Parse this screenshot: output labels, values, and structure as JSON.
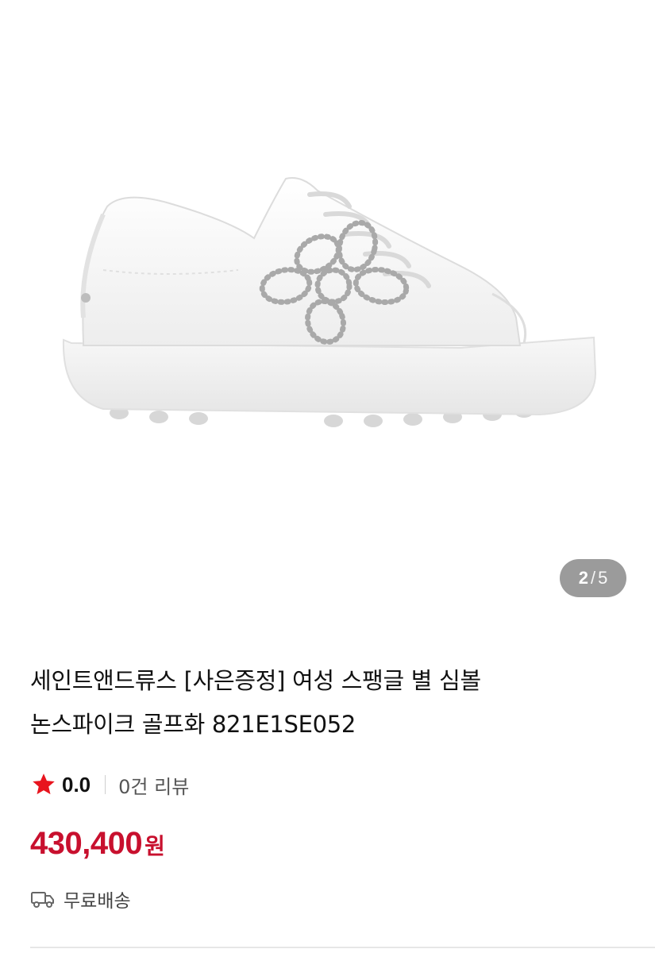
{
  "gallery": {
    "image_name": "white-golf-shoe-with-sequin-flower",
    "current": "2",
    "separator": "/",
    "total": "5"
  },
  "product": {
    "title_line1": "세인트앤드류스 [사은증정] 여성 스팽글 별 심볼",
    "title_line2": "논스파이크 골프화 821E1SE052",
    "rating": "0.0",
    "review_count": "0건 리뷰",
    "price": "430,400",
    "currency": "원",
    "shipping": "무료배송"
  },
  "icons": {
    "star": "star-icon",
    "truck": "delivery-truck-icon"
  },
  "colors": {
    "accent": "#c8102e",
    "star": "#e8141e",
    "indicator_bg": "#9b9b9b"
  }
}
